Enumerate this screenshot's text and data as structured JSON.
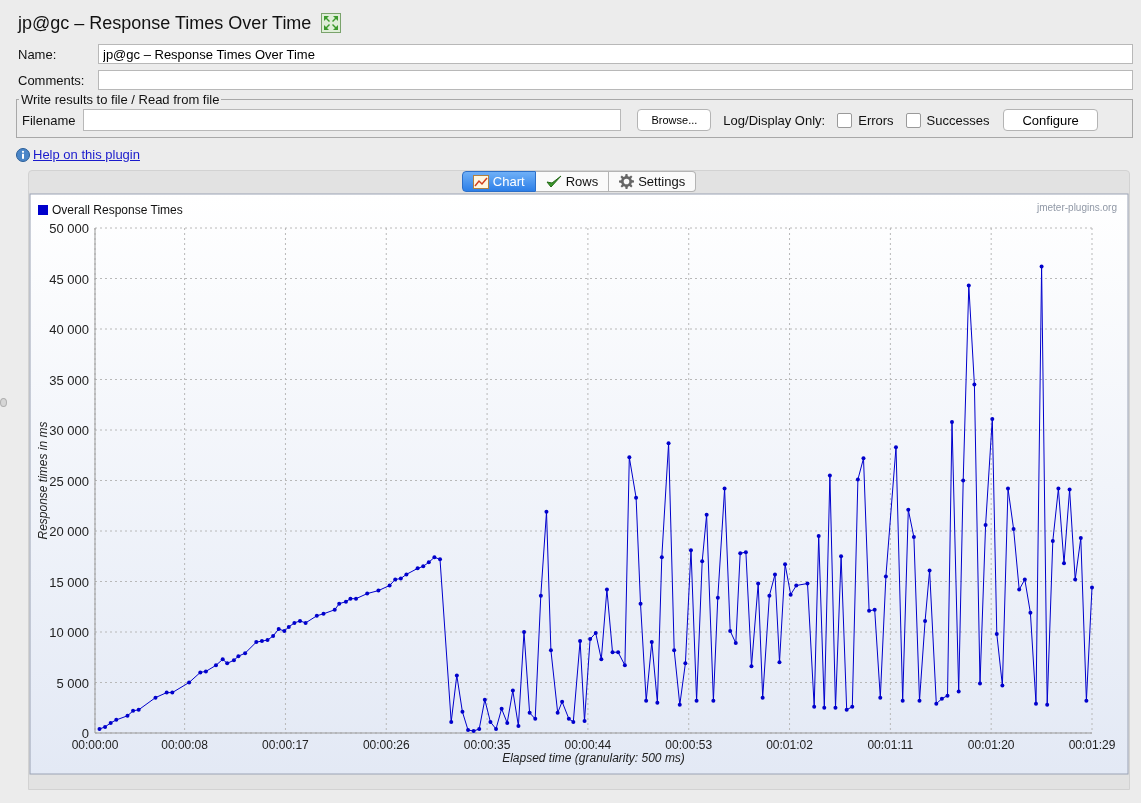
{
  "title": "jp@gc – Response Times Over Time",
  "name_field": {
    "label": "Name:",
    "value": "jp@gc – Response Times Over Time"
  },
  "comments_field": {
    "label": "Comments:"
  },
  "file_group": {
    "title": "Write results to file / Read from file",
    "filename_label": "Filename",
    "browse_button": "Browse...",
    "log_label": "Log/Display Only:",
    "checkboxes": [
      {
        "label": "Errors",
        "checked": false
      },
      {
        "label": "Successes",
        "checked": false
      }
    ],
    "configure_button": "Configure"
  },
  "help_link": "Help on this plugin",
  "tabs": [
    {
      "label": "Chart",
      "selected": true,
      "kind": "chart"
    },
    {
      "label": "Rows",
      "selected": false,
      "kind": "rows"
    },
    {
      "label": "Settings",
      "selected": false,
      "kind": "settings"
    }
  ],
  "chart": {
    "watermark": "jmeter-plugins.org",
    "chart_data": {
      "type": "line",
      "xlabel": "Elapsed time (granularity: 500 ms)",
      "ylabel": "Response times in ms",
      "x": [
        0.4,
        0.9,
        1.4,
        1.9,
        2.9,
        3.4,
        3.9,
        5.4,
        6.4,
        6.9,
        8.4,
        9.4,
        9.9,
        10.8,
        11.4,
        11.8,
        12.4,
        12.8,
        13.4,
        14.4,
        14.9,
        15.4,
        15.9,
        16.4,
        16.9,
        17.3,
        17.8,
        18.3,
        18.8,
        19.8,
        20.4,
        21.4,
        21.8,
        22.4,
        22.8,
        23.3,
        24.3,
        25.3,
        26.3,
        26.8,
        27.3,
        27.8,
        28.8,
        29.3,
        29.8,
        30.3,
        30.8,
        31.8,
        32.3,
        32.8,
        33.3,
        33.8,
        34.3,
        34.8,
        35.3,
        35.8,
        36.3,
        36.8,
        37.3,
        37.8,
        38.3,
        38.8,
        39.3,
        39.8,
        40.3,
        40.7,
        41.3,
        41.7,
        42.3,
        42.7,
        43.3,
        43.7,
        44.2,
        44.7,
        45.2,
        45.7,
        46.2,
        46.7,
        47.3,
        47.7,
        48.3,
        48.7,
        49.2,
        49.7,
        50.2,
        50.6,
        51.2,
        51.7,
        52.2,
        52.7,
        53.2,
        53.7,
        54.2,
        54.6,
        55.2,
        55.6,
        56.2,
        56.7,
        57.2,
        57.6,
        58.1,
        58.6,
        59.2,
        59.6,
        60.2,
        60.7,
        61.1,
        61.6,
        62.1,
        62.6,
        63.6,
        64.2,
        64.6,
        65.1,
        65.6,
        66.1,
        66.6,
        67.1,
        67.6,
        68.1,
        68.6,
        69.1,
        69.6,
        70.1,
        70.6,
        71.5,
        72.1,
        72.6,
        73.1,
        73.6,
        74.1,
        74.5,
        75.1,
        75.6,
        76.1,
        76.5,
        77.1,
        77.5,
        78.0,
        78.5,
        79.0,
        79.5,
        80.1,
        80.5,
        81.0,
        81.5,
        82.0,
        82.5,
        83.0,
        83.5,
        84.0,
        84.5,
        85.0,
        85.5,
        86.0,
        86.5,
        87.0,
        87.5,
        88.0,
        88.5,
        89.0
      ],
      "series": [
        {
          "name": "Overall Response Times",
          "color": "#0000cc",
          "values": [
            400,
            600,
            1000,
            1300,
            1700,
            2200,
            2300,
            3500,
            4000,
            4000,
            5000,
            6000,
            6100,
            6700,
            7300,
            6900,
            7200,
            7600,
            7900,
            9000,
            9100,
            9200,
            9600,
            10300,
            10100,
            10500,
            10900,
            11100,
            10900,
            11600,
            11800,
            12200,
            12800,
            13000,
            13300,
            13300,
            13800,
            14100,
            14600,
            15200,
            15300,
            15700,
            16300,
            16500,
            16900,
            17400,
            17200,
            1100,
            5700,
            2100,
            300,
            200,
            400,
            3300,
            1100,
            400,
            2400,
            1000,
            4200,
            700,
            10000,
            2000,
            1400,
            13600,
            21900,
            8200,
            2000,
            3100,
            1400,
            1100,
            9100,
            1200,
            9300,
            9900,
            7300,
            14200,
            8000,
            8000,
            6700,
            27300,
            23300,
            12800,
            3200,
            9000,
            3000,
            17400,
            28700,
            8200,
            2800,
            6900,
            18100,
            3200,
            17000,
            21600,
            3200,
            13400,
            24200,
            10100,
            8900,
            17800,
            17900,
            6600,
            14800,
            3500,
            13600,
            15700,
            7000,
            16700,
            13700,
            14600,
            14800,
            2600,
            19500,
            2500,
            25500,
            2500,
            17500,
            2300,
            2600,
            25100,
            27200,
            12100,
            12200,
            3500,
            15500,
            28300,
            3200,
            22100,
            19400,
            3200,
            11100,
            16100,
            2900,
            3400,
            3700,
            30800,
            4100,
            25000,
            44300,
            34500,
            4900,
            20600,
            31100,
            9800,
            4700,
            24200,
            20200,
            14200,
            15200,
            11900,
            2900,
            46200,
            2800,
            19000,
            24200,
            16800,
            24100,
            15200,
            19300,
            3200,
            14400
          ]
        }
      ],
      "xlim": [
        0,
        89
      ],
      "ylim": [
        0,
        50000
      ],
      "grid": true,
      "xticks": [
        {
          "value": 0,
          "label": "00:00:00"
        },
        {
          "value": 8,
          "label": "00:00:08"
        },
        {
          "value": 17,
          "label": "00:00:17"
        },
        {
          "value": 26,
          "label": "00:00:26"
        },
        {
          "value": 35,
          "label": "00:00:35"
        },
        {
          "value": 44,
          "label": "00:00:44"
        },
        {
          "value": 53,
          "label": "00:00:53"
        },
        {
          "value": 62,
          "label": "00:01:02"
        },
        {
          "value": 71,
          "label": "00:01:11"
        },
        {
          "value": 80,
          "label": "00:01:20"
        },
        {
          "value": 89,
          "label": "00:01:29"
        }
      ],
      "yticks": [
        {
          "value": 0,
          "label": "0"
        },
        {
          "value": 5000,
          "label": "5 000"
        },
        {
          "value": 10000,
          "label": "10 000"
        },
        {
          "value": 15000,
          "label": "15 000"
        },
        {
          "value": 20000,
          "label": "20 000"
        },
        {
          "value": 25000,
          "label": "25 000"
        },
        {
          "value": 30000,
          "label": "30 000"
        },
        {
          "value": 35000,
          "label": "35 000"
        },
        {
          "value": 40000,
          "label": "40 000"
        },
        {
          "value": 45000,
          "label": "45 000"
        },
        {
          "value": 50000,
          "label": "50 000"
        }
      ]
    }
  }
}
